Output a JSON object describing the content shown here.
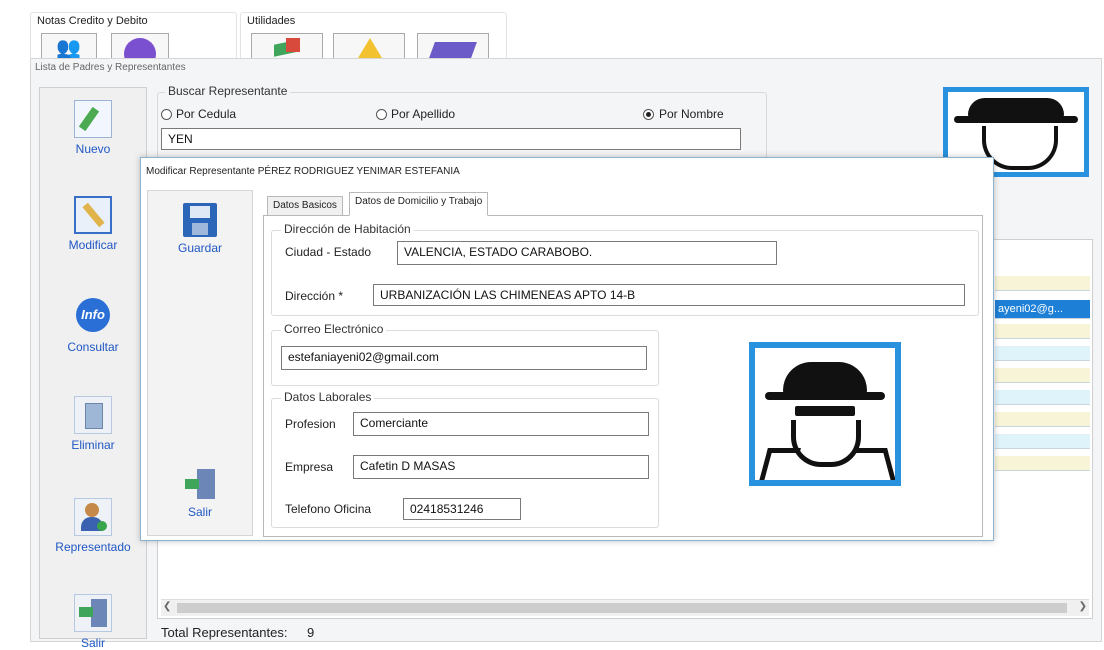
{
  "toolbar": {
    "group_notas": "Notas Credito y Debito",
    "group_utilidades": "Utilidades"
  },
  "lista": {
    "title": "Lista de Padres y Representantes",
    "search_group": "Buscar Representante",
    "radio_cedula": "Por Cedula",
    "radio_apellido": "Por Apellido",
    "radio_nombre": "Por Nombre",
    "search_value": "YEN",
    "side_buttons": {
      "nuevo": "Nuevo",
      "modificar": "Modificar",
      "consultar": "Consultar",
      "eliminar": "Eliminar",
      "representado": "Representado",
      "salir": "Salir"
    },
    "email_cell": "ayeni02@g...",
    "total_label": "Total Representantes:",
    "total_value": "9"
  },
  "modal": {
    "title": "Modificar Representante PÉREZ RODRIGUEZ YENIMAR ESTEFANIA",
    "guardar": "Guardar",
    "salir": "Salir",
    "tab_basicos": "Datos Basicos",
    "tab_domicilio": "Datos de Domicilio y Trabajo",
    "habitacion_group": "Dirección de Habitación",
    "ciudad_label": "Ciudad - Estado",
    "ciudad_value": "VALENCIA, ESTADO CARABOBO.",
    "direccion_label": "Dirección *",
    "direccion_value": "URBANIZACIÓN LAS CHIMENEAS APTO 14-B",
    "correo_group": "Correo Electrónico",
    "correo_value": "estefaniayeni02@gmail.com",
    "laborales_group": "Datos Laborales",
    "profesion_label": "Profesion",
    "profesion_value": "Comerciante",
    "empresa_label": "Empresa",
    "empresa_value": "Cafetin D MASAS",
    "telefono_label": "Telefono Oficina",
    "telefono_value": "02418531246"
  },
  "colors": {
    "accent_blue": "#1f57c4",
    "photo_border": "#1e8ed8",
    "row_yellow": "#f8f4d8",
    "row_cyan": "#dff3fb"
  }
}
